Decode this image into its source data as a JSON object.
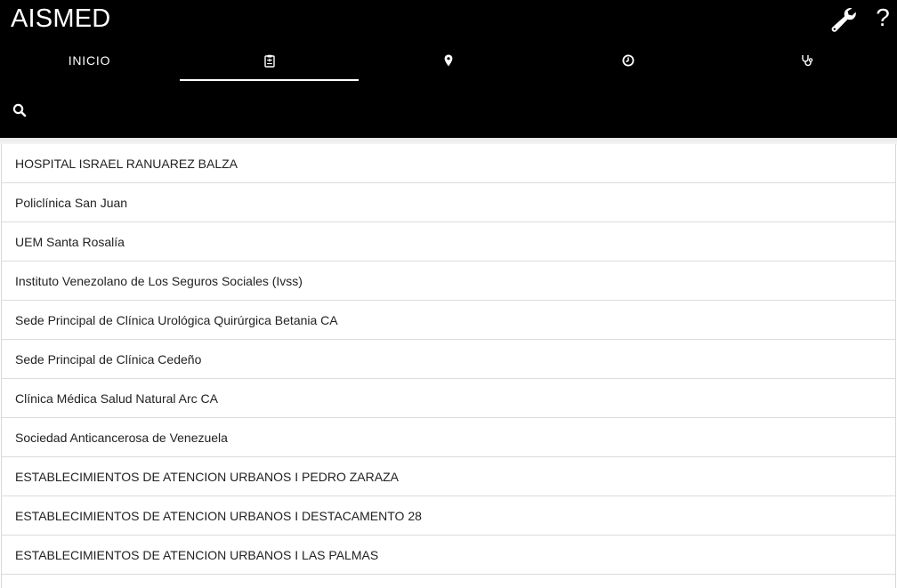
{
  "app": {
    "title": "AISMED"
  },
  "toolbar": {
    "help_label": "?",
    "settings_icon": "wrench-icon",
    "help_icon": "question-mark"
  },
  "tabs": [
    {
      "label": "INICIO",
      "icon": null,
      "active": false
    },
    {
      "label": "",
      "icon": "clipboard-icon",
      "active": true
    },
    {
      "label": "",
      "icon": "map-marker-icon",
      "active": false
    },
    {
      "label": "",
      "icon": "clock-icon",
      "active": false
    },
    {
      "label": "",
      "icon": "stethoscope-icon",
      "active": false
    }
  ],
  "search": {
    "icon": "search-icon"
  },
  "list": {
    "items": [
      "HOSPITAL ISRAEL RANUAREZ BALZA",
      "Policlínica San Juan",
      "UEM Santa Rosalía",
      "Instituto Venezolano de Los Seguros Sociales (Ivss)",
      "Sede Principal de Clínica Urológica Quirúrgica Betania CA",
      "Sede Principal de Clínica Cedeño",
      "Clínica Médica Salud Natural Arc CA",
      "Sociedad Anticancerosa de Venezuela",
      "ESTABLECIMIENTOS DE ATENCION URBANOS I PEDRO ZARAZA",
      "ESTABLECIMIENTOS DE ATENCION URBANOS I DESTACAMENTO 28",
      "ESTABLECIMIENTOS DE ATENCION URBANOS I LAS PALMAS",
      ""
    ]
  },
  "colors": {
    "appbar": "#000000",
    "appbar_text": "#ffffff",
    "list_text": "#222222",
    "divider": "#dcdcdc"
  }
}
